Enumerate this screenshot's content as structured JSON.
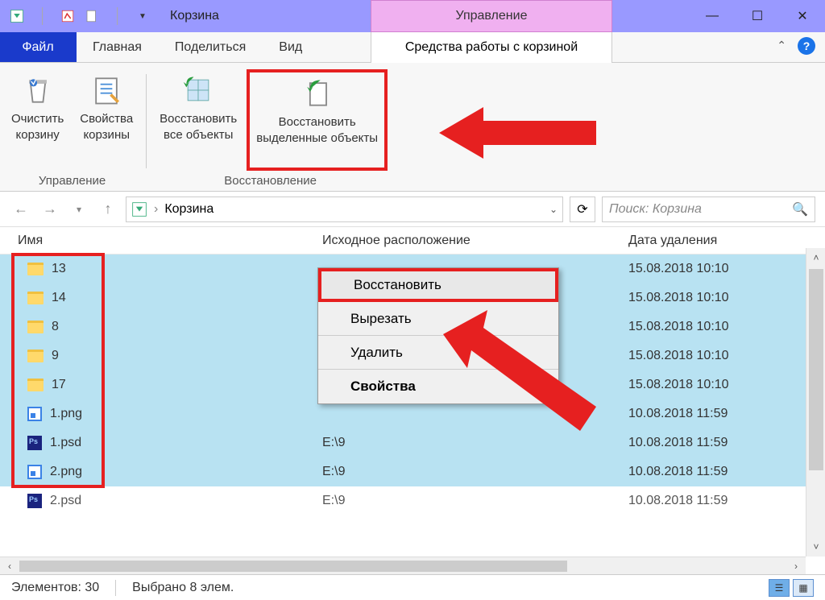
{
  "titlebar": {
    "title": "Корзина",
    "manage": "Управление"
  },
  "tabs": {
    "file": "Файл",
    "home": "Главная",
    "share": "Поделиться",
    "view": "Вид",
    "context": "Средства работы с корзиной"
  },
  "ribbon": {
    "group1_label": "Управление",
    "group2_label": "Восстановление",
    "empty": "Очистить\nкорзину",
    "props": "Свойства\nкорзины",
    "restore_all": "Восстановить\nвсе объекты",
    "restore_sel": "Восстановить\nвыделенные объекты"
  },
  "nav": {
    "breadcrumb": "Корзина",
    "search_placeholder": "Поиск: Корзина"
  },
  "columns": {
    "name": "Имя",
    "loc": "Исходное расположение",
    "date": "Дата удаления"
  },
  "rows": [
    {
      "type": "folder",
      "name": "13",
      "loc": "",
      "date": "15.08.2018 10:10",
      "sel": true
    },
    {
      "type": "folder",
      "name": "14",
      "loc": "",
      "date": "15.08.2018 10:10",
      "sel": true
    },
    {
      "type": "folder",
      "name": "8",
      "loc": "",
      "date": "15.08.2018 10:10",
      "sel": true
    },
    {
      "type": "folder",
      "name": "9",
      "loc": "",
      "date": "15.08.2018 10:10",
      "sel": true
    },
    {
      "type": "folder",
      "name": "17",
      "loc": "",
      "date": "15.08.2018 10:10",
      "sel": true
    },
    {
      "type": "png",
      "name": "1.png",
      "loc": "",
      "date": "10.08.2018 11:59",
      "sel": true
    },
    {
      "type": "psd",
      "name": "1.psd",
      "loc": "E:\\9",
      "date": "10.08.2018 11:59",
      "sel": true
    },
    {
      "type": "png",
      "name": "2.png",
      "loc": "E:\\9",
      "date": "10.08.2018 11:59",
      "sel": true
    },
    {
      "type": "psd",
      "name": "2.psd",
      "loc": "E:\\9",
      "date": "10.08.2018 11:59",
      "sel": false
    }
  ],
  "context_menu": {
    "restore": "Восстановить",
    "cut": "Вырезать",
    "delete": "Удалить",
    "props": "Свойства"
  },
  "status": {
    "elements": "Элементов: 30",
    "selected": "Выбрано 8 элем."
  }
}
